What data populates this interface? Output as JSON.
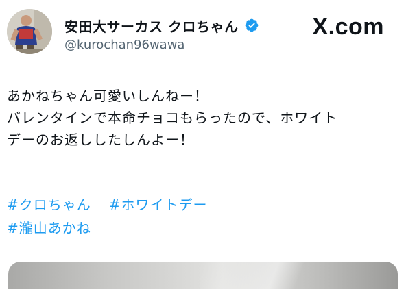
{
  "profile": {
    "display_name": "安田大サーカス クロちゃん",
    "handle": "@kurochan96wawa"
  },
  "brand": {
    "text": "X.com"
  },
  "tweet": {
    "lines": [
      "あかねちゃん可愛いしんねー！",
      "バレンタインで本命チョコもらったので、ホワイト",
      "デーのお返ししたしんよー！"
    ],
    "hashtags": [
      "#クロちゃん",
      "#ホワイトデー",
      "#瀧山あかね"
    ]
  },
  "colors": {
    "link": "#1d9bf0",
    "verified": "#1d9bf0",
    "handle": "#536471",
    "text": "#0f1419"
  },
  "icons": {
    "verified": "verified-badge-icon",
    "brand": "x-logo-icon"
  }
}
